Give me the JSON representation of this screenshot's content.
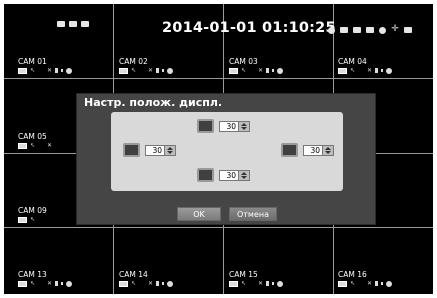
{
  "status_bar": {
    "datetime": "2014-01-01 01:10:25",
    "left_icons": [
      "hdd-icon",
      "network-icon",
      "record-icon"
    ],
    "right_icons": [
      "alarm-icon",
      "storage-icon",
      "user-icon",
      "lock-icon",
      "zoom-icon",
      "ptz-icon",
      "menu-icon"
    ]
  },
  "cameras": {
    "cam01": "CAM 01",
    "cam02": "CAM 02",
    "cam03": "CAM 03",
    "cam04": "CAM 04",
    "cam05": "CAM 05",
    "cam09": "CAM 09",
    "cam13": "CAM 13",
    "cam14": "CAM 14",
    "cam15": "CAM 15",
    "cam16": "CAM 16"
  },
  "dialog": {
    "title": "Настр. полож. диспл.",
    "top_value": "30",
    "left_value": "30",
    "right_value": "30",
    "bottom_value": "30",
    "ok_label": "OK",
    "cancel_label": "Отмена"
  },
  "colors": {
    "background": "#000000",
    "grid": "#9a9a9a",
    "dialog": "#454545",
    "panel": "#d9d9d9"
  }
}
